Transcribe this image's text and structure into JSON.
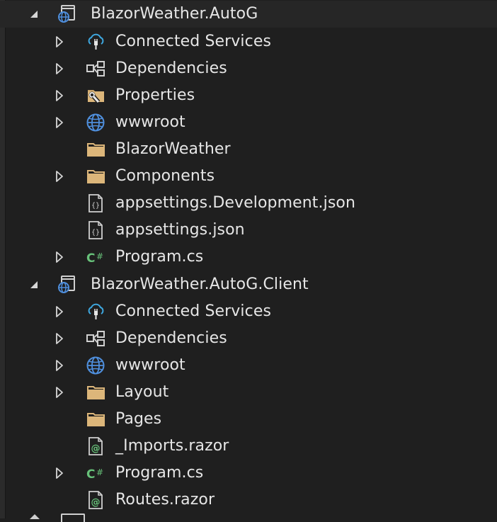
{
  "colors": {
    "background": "#1f1f1f",
    "text": "#e6e6e6",
    "folder": "#dcb67a",
    "globe": "#4f8fdd",
    "csharp": "#68c27a",
    "razor": "#68c27a",
    "cloud": "#3ea8e0"
  },
  "tree": {
    "projects": [
      {
        "name": "BlazorWeather.AutoG",
        "expanded": true,
        "icon": "web-project-icon",
        "children": [
          {
            "label": "Connected Services",
            "icon": "connected-services-icon",
            "expandable": true
          },
          {
            "label": "Dependencies",
            "icon": "dependencies-icon",
            "expandable": true
          },
          {
            "label": "Properties",
            "icon": "properties-folder-icon",
            "expandable": true
          },
          {
            "label": "wwwroot",
            "icon": "globe-icon",
            "expandable": true
          },
          {
            "label": "BlazorWeather",
            "icon": "folder-icon",
            "expandable": false
          },
          {
            "label": "Components",
            "icon": "folder-icon",
            "expandable": true
          },
          {
            "label": "appsettings.Development.json",
            "icon": "json-file-icon",
            "expandable": false
          },
          {
            "label": "appsettings.json",
            "icon": "json-file-icon",
            "expandable": false
          },
          {
            "label": "Program.cs",
            "icon": "csharp-file-icon",
            "expandable": true
          }
        ]
      },
      {
        "name": "BlazorWeather.AutoG.Client",
        "expanded": true,
        "icon": "web-project-icon",
        "children": [
          {
            "label": "Connected Services",
            "icon": "connected-services-icon",
            "expandable": true
          },
          {
            "label": "Dependencies",
            "icon": "dependencies-icon",
            "expandable": true
          },
          {
            "label": "wwwroot",
            "icon": "globe-icon",
            "expandable": true
          },
          {
            "label": "Layout",
            "icon": "folder-icon",
            "expandable": true
          },
          {
            "label": "Pages",
            "icon": "folder-icon",
            "expandable": false
          },
          {
            "label": "_Imports.razor",
            "icon": "razor-file-icon",
            "expandable": false
          },
          {
            "label": "Program.cs",
            "icon": "csharp-file-icon",
            "expandable": true
          },
          {
            "label": "Routes.razor",
            "icon": "razor-file-icon",
            "expandable": false
          }
        ]
      }
    ]
  }
}
